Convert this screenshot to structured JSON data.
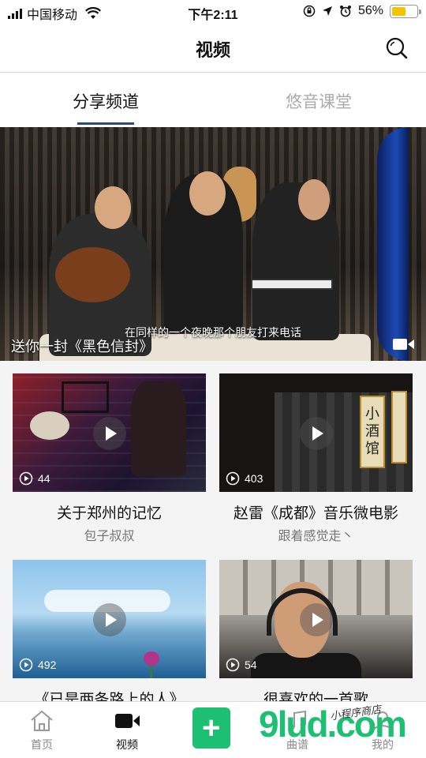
{
  "status_bar": {
    "carrier": "中国移动",
    "time": "下午2:11",
    "battery": "56%",
    "battery_level": 0.56,
    "battery_color": "#f5c400"
  },
  "nav": {
    "title": "视频",
    "search_icon": "search-icon"
  },
  "tabs": [
    {
      "label": "分享频道",
      "active": true
    },
    {
      "label": "悠音课堂",
      "active": false
    }
  ],
  "accent_color": "#2f4a85",
  "hero": {
    "title": "送你一封《黑色信封》",
    "subtitle": "在同样的一个夜晚那个朋友打来电话",
    "icon": "video-camera-icon"
  },
  "videos": [
    {
      "title": "关于郑州的记忆",
      "author": "包子叔叔",
      "plays": "44"
    },
    {
      "title": "赵雷《成都》音乐微电影",
      "author": "跟着感觉走丶",
      "plays": "403",
      "thumb_sign": "小酒馆"
    },
    {
      "title": "《已是两条路上的人》",
      "author": "",
      "plays": "492"
    },
    {
      "title": "很喜欢的一首歌",
      "author": "",
      "plays": "54"
    }
  ],
  "tab_bar": [
    {
      "label": "首页",
      "icon": "home-icon",
      "active": false
    },
    {
      "label": "视频",
      "icon": "video-camera-icon",
      "active": true
    },
    {
      "label": "曲谱",
      "icon": "score-icon",
      "active": false
    },
    {
      "label": "我的",
      "icon": "user-icon",
      "active": false
    }
  ],
  "watermark": {
    "brand": "9lud.com",
    "tagline": "小程序商店"
  }
}
